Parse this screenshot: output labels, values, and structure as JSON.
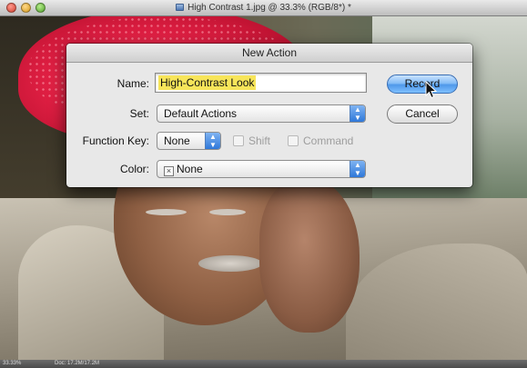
{
  "window": {
    "title": "High Contrast 1.jpg @ 33.3% (RGB/8*) *",
    "status_zoom": "33.33%",
    "status_doc": "Doc: 17.2M/17.2M"
  },
  "dialog": {
    "title": "New Action",
    "name_label": "Name:",
    "name_value": "High-Contrast Look",
    "set_label": "Set:",
    "set_value": "Default Actions",
    "function_key_label": "Function Key:",
    "function_key_value": "None",
    "shift_label": "Shift",
    "command_label": "Command",
    "color_label": "Color:",
    "color_value": "None",
    "record_label": "Record",
    "cancel_label": "Cancel"
  },
  "colors": {
    "selection_highlight": "#f7e55a",
    "default_button": "#4f98ea",
    "turban": "#e01f43"
  }
}
